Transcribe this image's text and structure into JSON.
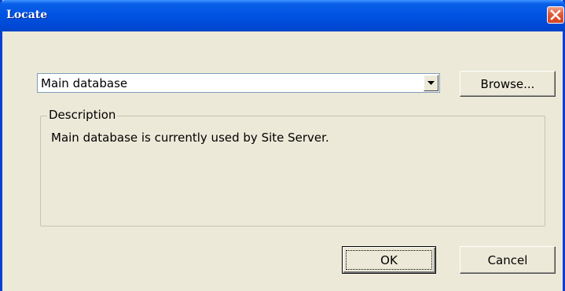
{
  "window": {
    "title": "Locate"
  },
  "database_select": {
    "value": "Main database"
  },
  "buttons": {
    "browse": "Browse...",
    "ok": "OK",
    "cancel": "Cancel"
  },
  "description": {
    "label": "Description",
    "text": "Main database is currently used by Site Server."
  },
  "icons": {
    "close": "close-icon",
    "dropdown": "chevron-down-icon"
  },
  "colors": {
    "titlebar": "#0054e3",
    "dialog_bg": "#ece9d8",
    "close_button": "#d7421f"
  }
}
